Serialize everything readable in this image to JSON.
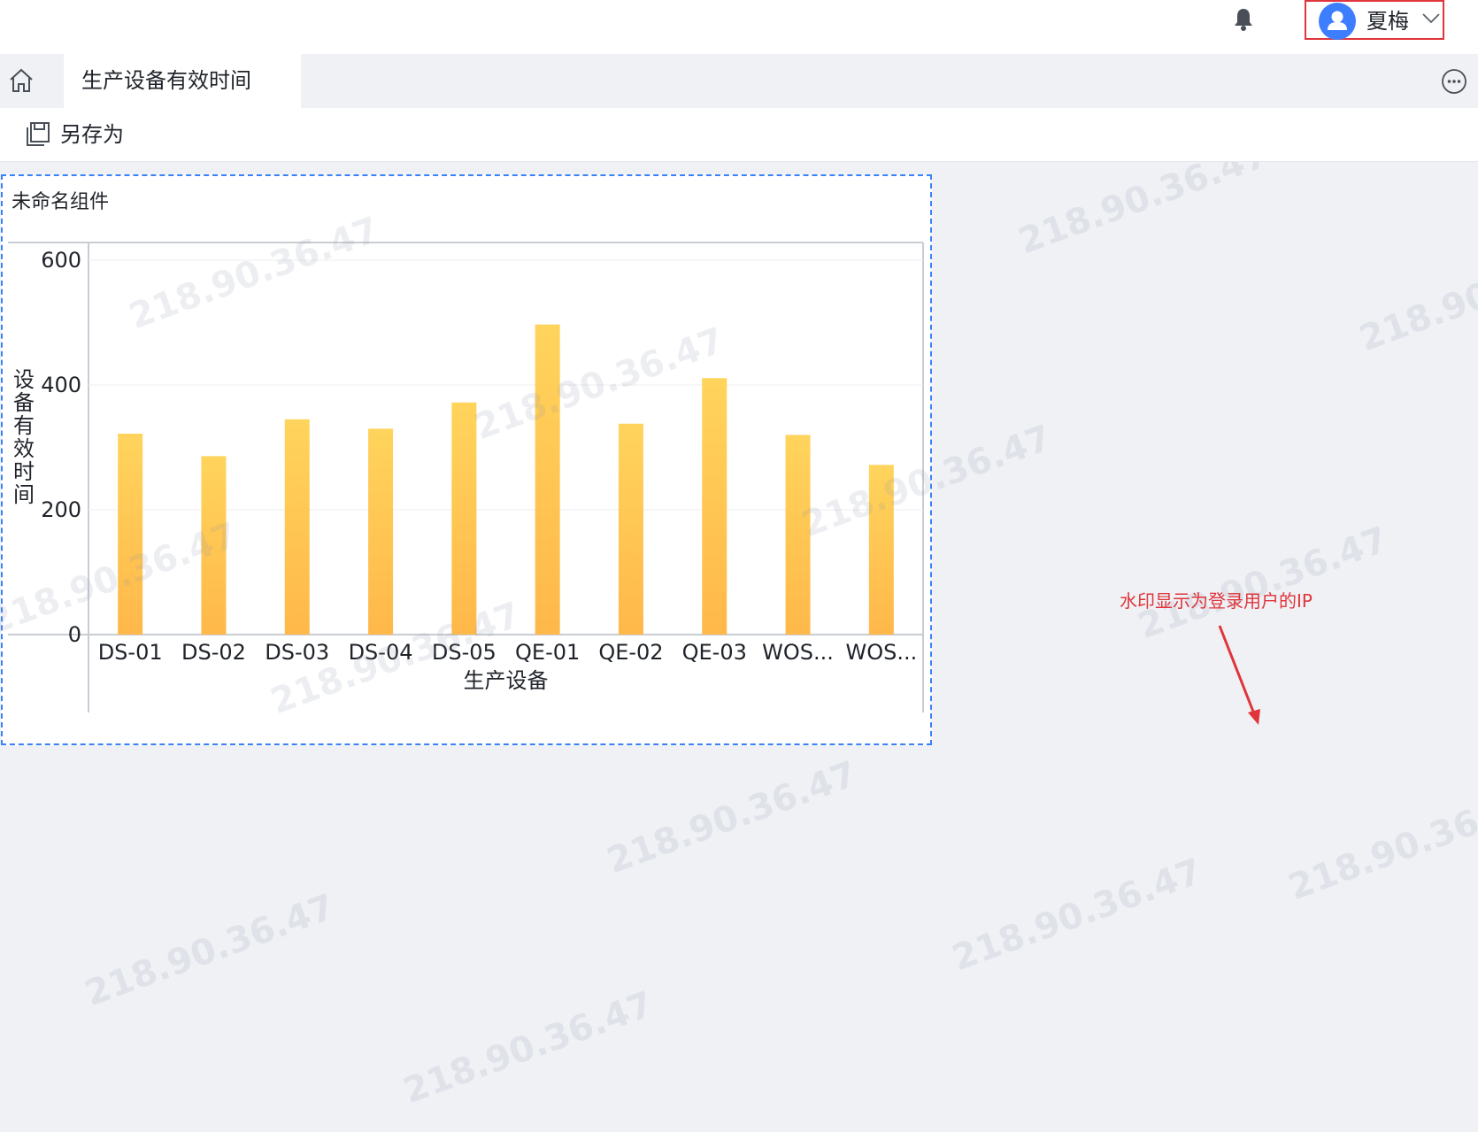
{
  "header": {
    "user_name": "夏梅",
    "icons": {
      "bell": "bell-icon",
      "avatar": "user-avatar-icon",
      "dropdown": "chevron-down-icon"
    }
  },
  "tabs": {
    "home_icon": "home-icon",
    "active_tab_label": "生产设备有效时间",
    "more_icon": "more-options-icon"
  },
  "toolbar": {
    "save_as_label": "另存为",
    "save_as_icon": "save-as-icon"
  },
  "widget": {
    "title": "未命名组件"
  },
  "watermark": {
    "text": "218.90.36.47"
  },
  "annotation": {
    "text": "水印显示为登录用户的IP",
    "color": "#e0353b"
  },
  "colors": {
    "bar_top": "#ffd45c",
    "bar_bottom": "#ffb84a",
    "selection_border": "#3a82f7",
    "highlight_border": "#e0353b",
    "avatar": "#3d7eff"
  },
  "chart_data": {
    "type": "bar",
    "categories": [
      "DS-01",
      "DS-02",
      "DS-03",
      "DS-04",
      "DS-05",
      "QE-01",
      "QE-02",
      "QE-03",
      "WOS...",
      "WOS..."
    ],
    "values": [
      322,
      286,
      345,
      330,
      372,
      497,
      338,
      411,
      320,
      272
    ],
    "xlabel": "生产设备",
    "ylabel": "设备有效时间",
    "yticks": [
      0,
      200,
      400,
      600
    ],
    "ylim": [
      0,
      600
    ],
    "grid": true,
    "legend": "none"
  }
}
